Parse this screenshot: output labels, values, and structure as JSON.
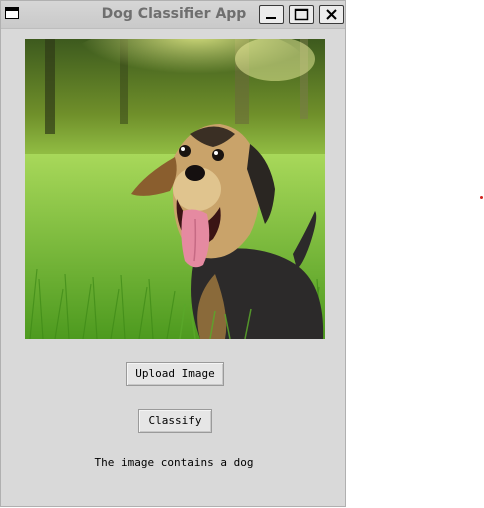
{
  "window": {
    "title": "Dog Classifier App"
  },
  "photo": {
    "subject": "dog"
  },
  "buttons": {
    "upload_label": "Upload Image",
    "classify_label": "Classify"
  },
  "result": {
    "text": "The image contains a dog"
  },
  "colors": {
    "window_bg": "#d9d9d9",
    "title_text": "#6f6f6f",
    "grass": "#7cc63a",
    "background_marker": "#d0201c"
  },
  "icons": [
    "window-menu-icon",
    "minimize-icon",
    "maximize-icon",
    "close-icon"
  ]
}
